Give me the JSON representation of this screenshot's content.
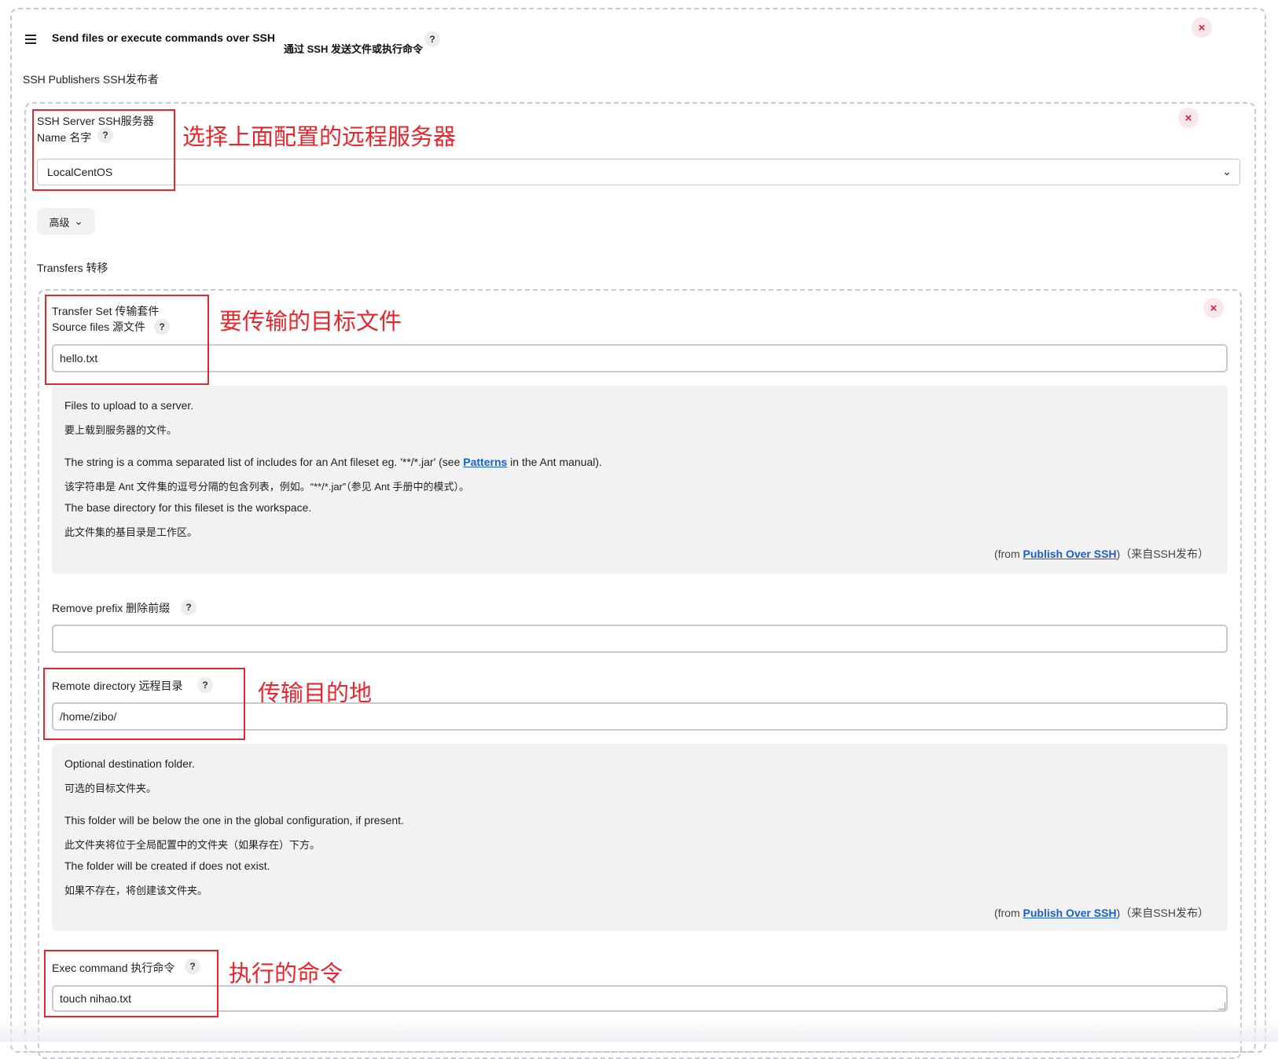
{
  "step": {
    "title": "Send files or execute commands over SSH",
    "title_cn": "通过 SSH 发送文件或执行命令",
    "help": "?",
    "close": "×"
  },
  "publishers_label": "SSH Publishers SSH发布者",
  "server": {
    "label_line1": "SSH Server SSH服务器",
    "label_line2": "Name 名字",
    "help": "?",
    "close": "×",
    "selected": "LocalCentOS",
    "chevron": "⌄",
    "annotation": "选择上面配置的远程服务器"
  },
  "advanced": {
    "label": "高级",
    "chevron": "⌄"
  },
  "transfers_label": "Transfers 转移",
  "transfer_set": {
    "label_line1": "Transfer Set 传输套件",
    "label_line2": "Source files 源文件",
    "help": "?",
    "close": "×",
    "value": "hello.txt",
    "annotation": "要传输的目标文件",
    "helpbox": {
      "l1": "Files to upload to a server.",
      "l2": "要上载到服务器的文件。",
      "l3_pre": "The string is a comma separated list of includes for an Ant fileset eg. '**/*.jar' (see ",
      "l3_link": "Patterns",
      "l3_post": " in the Ant manual).",
      "l4": "该字符串是 Ant 文件集的逗号分隔的包含列表，例如。“**/*.jar”（参见 Ant 手册中的模式）。",
      "l5": "The base directory for this fileset is the workspace.",
      "l6": "此文件集的基目录是工作区。",
      "from_pre": "(from ",
      "from_link": "Publish Over SSH",
      "from_post": ")（来自SSH发布）"
    }
  },
  "remove_prefix": {
    "label": "Remove prefix 删除前缀",
    "help": "?",
    "value": ""
  },
  "remote_dir": {
    "label": "Remote directory 远程目录",
    "help": "?",
    "value": "/home/zibo/",
    "annotation": "传输目的地",
    "helpbox": {
      "l1": "Optional destination folder.",
      "l2": "可选的目标文件夹。",
      "l3": "This folder will be below the one in the global configuration, if present.",
      "l4": "此文件夹将位于全局配置中的文件夹（如果存在）下方。",
      "l5": "The folder will be created if does not exist.",
      "l6": "如果不存在，将创建该文件夹。",
      "from_pre": "(from ",
      "from_link": "Publish Over SSH",
      "from_post": ")（来自SSH发布）"
    }
  },
  "exec": {
    "label": "Exec command 执行命令",
    "help": "?",
    "value": "touch nihao.txt",
    "annotation": "执行的命令"
  },
  "colors": {
    "annotation": "#e8262d",
    "link": "#1a5fd0",
    "close": "#d0243c"
  }
}
